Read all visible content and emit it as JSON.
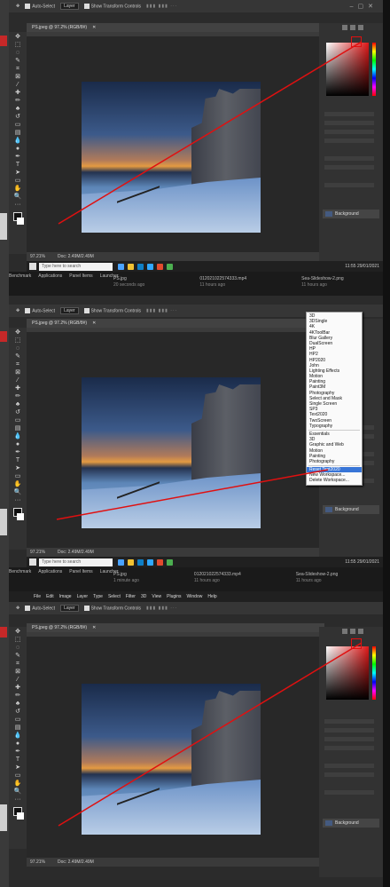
{
  "menubar": [
    "File",
    "Edit",
    "Image",
    "Layer",
    "Type",
    "Select",
    "Filter",
    "3D",
    "View",
    "Plugins",
    "Window",
    "Help"
  ],
  "options": {
    "auto_select": "Auto-Select",
    "layer": "Layer",
    "transform": "Show Transform Controls"
  },
  "document": {
    "title": "PS.jpeg @ 97.2% (RGB/8#)",
    "zoom": "97.21%",
    "doc_info": "Doc: 2.49M/2.49M"
  },
  "taskbar": {
    "search": "Type here to search",
    "time": "11:55",
    "date": "29/01/2021"
  },
  "bottom": {
    "bookmarks": [
      "Benchmark",
      "Applications",
      "Panel Items",
      "Launcher"
    ],
    "files": [
      {
        "name": "PS.jpg",
        "sub": "20 seconds ago"
      },
      {
        "name": "012021022574333.mp4",
        "sub": "11 hours ago"
      },
      {
        "name": "Sea-Slideshow-2.png",
        "sub": "11 hours ago"
      }
    ],
    "files2": [
      {
        "name": "PS.jpg",
        "sub": "1 minute ago"
      },
      {
        "name": "012021022574333.mp4",
        "sub": "11 hours ago"
      },
      {
        "name": "Sea-Slideshow-2.png",
        "sub": "11 hours ago"
      }
    ]
  },
  "layer_name": "Background",
  "workspace_menu": {
    "items": [
      "3D",
      "3DSingle",
      "4K",
      "4KToolBar",
      "Blur Gallery",
      "DualScreen",
      "HP",
      "HP2",
      "HP2020",
      "John",
      "Lighting Effects",
      "Motion",
      "Painting",
      "Paint3M",
      "Photography",
      "Select and Mask",
      "Single Screen",
      "SP3",
      "Text2020",
      "TwoScreen",
      "Typography"
    ],
    "essentials": [
      "Essentials",
      "3D",
      "Graphic and Web",
      "Motion",
      "Painting",
      "Photography"
    ],
    "actions": [
      "Reset Text2020",
      "New Workspace...",
      "Delete Workspace..."
    ]
  },
  "colors": {
    "arrow": "#e01010",
    "menu_highlight": "#3875d7"
  }
}
